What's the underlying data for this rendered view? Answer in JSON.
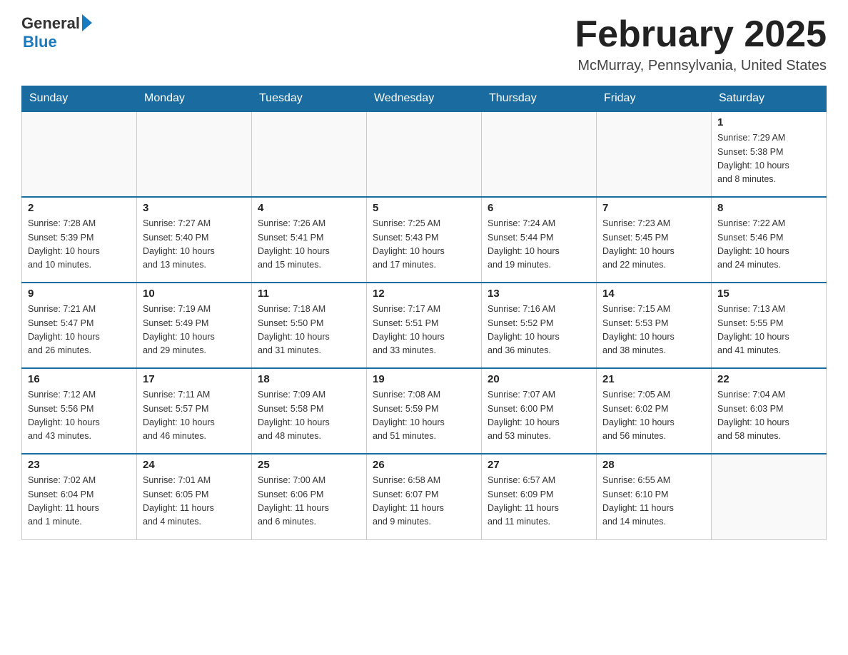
{
  "logo": {
    "general": "General",
    "blue": "Blue"
  },
  "title": "February 2025",
  "location": "McMurray, Pennsylvania, United States",
  "headers": [
    "Sunday",
    "Monday",
    "Tuesday",
    "Wednesday",
    "Thursday",
    "Friday",
    "Saturday"
  ],
  "weeks": [
    [
      {
        "day": "",
        "info": ""
      },
      {
        "day": "",
        "info": ""
      },
      {
        "day": "",
        "info": ""
      },
      {
        "day": "",
        "info": ""
      },
      {
        "day": "",
        "info": ""
      },
      {
        "day": "",
        "info": ""
      },
      {
        "day": "1",
        "info": "Sunrise: 7:29 AM\nSunset: 5:38 PM\nDaylight: 10 hours\nand 8 minutes."
      }
    ],
    [
      {
        "day": "2",
        "info": "Sunrise: 7:28 AM\nSunset: 5:39 PM\nDaylight: 10 hours\nand 10 minutes."
      },
      {
        "day": "3",
        "info": "Sunrise: 7:27 AM\nSunset: 5:40 PM\nDaylight: 10 hours\nand 13 minutes."
      },
      {
        "day": "4",
        "info": "Sunrise: 7:26 AM\nSunset: 5:41 PM\nDaylight: 10 hours\nand 15 minutes."
      },
      {
        "day": "5",
        "info": "Sunrise: 7:25 AM\nSunset: 5:43 PM\nDaylight: 10 hours\nand 17 minutes."
      },
      {
        "day": "6",
        "info": "Sunrise: 7:24 AM\nSunset: 5:44 PM\nDaylight: 10 hours\nand 19 minutes."
      },
      {
        "day": "7",
        "info": "Sunrise: 7:23 AM\nSunset: 5:45 PM\nDaylight: 10 hours\nand 22 minutes."
      },
      {
        "day": "8",
        "info": "Sunrise: 7:22 AM\nSunset: 5:46 PM\nDaylight: 10 hours\nand 24 minutes."
      }
    ],
    [
      {
        "day": "9",
        "info": "Sunrise: 7:21 AM\nSunset: 5:47 PM\nDaylight: 10 hours\nand 26 minutes."
      },
      {
        "day": "10",
        "info": "Sunrise: 7:19 AM\nSunset: 5:49 PM\nDaylight: 10 hours\nand 29 minutes."
      },
      {
        "day": "11",
        "info": "Sunrise: 7:18 AM\nSunset: 5:50 PM\nDaylight: 10 hours\nand 31 minutes."
      },
      {
        "day": "12",
        "info": "Sunrise: 7:17 AM\nSunset: 5:51 PM\nDaylight: 10 hours\nand 33 minutes."
      },
      {
        "day": "13",
        "info": "Sunrise: 7:16 AM\nSunset: 5:52 PM\nDaylight: 10 hours\nand 36 minutes."
      },
      {
        "day": "14",
        "info": "Sunrise: 7:15 AM\nSunset: 5:53 PM\nDaylight: 10 hours\nand 38 minutes."
      },
      {
        "day": "15",
        "info": "Sunrise: 7:13 AM\nSunset: 5:55 PM\nDaylight: 10 hours\nand 41 minutes."
      }
    ],
    [
      {
        "day": "16",
        "info": "Sunrise: 7:12 AM\nSunset: 5:56 PM\nDaylight: 10 hours\nand 43 minutes."
      },
      {
        "day": "17",
        "info": "Sunrise: 7:11 AM\nSunset: 5:57 PM\nDaylight: 10 hours\nand 46 minutes."
      },
      {
        "day": "18",
        "info": "Sunrise: 7:09 AM\nSunset: 5:58 PM\nDaylight: 10 hours\nand 48 minutes."
      },
      {
        "day": "19",
        "info": "Sunrise: 7:08 AM\nSunset: 5:59 PM\nDaylight: 10 hours\nand 51 minutes."
      },
      {
        "day": "20",
        "info": "Sunrise: 7:07 AM\nSunset: 6:00 PM\nDaylight: 10 hours\nand 53 minutes."
      },
      {
        "day": "21",
        "info": "Sunrise: 7:05 AM\nSunset: 6:02 PM\nDaylight: 10 hours\nand 56 minutes."
      },
      {
        "day": "22",
        "info": "Sunrise: 7:04 AM\nSunset: 6:03 PM\nDaylight: 10 hours\nand 58 minutes."
      }
    ],
    [
      {
        "day": "23",
        "info": "Sunrise: 7:02 AM\nSunset: 6:04 PM\nDaylight: 11 hours\nand 1 minute."
      },
      {
        "day": "24",
        "info": "Sunrise: 7:01 AM\nSunset: 6:05 PM\nDaylight: 11 hours\nand 4 minutes."
      },
      {
        "day": "25",
        "info": "Sunrise: 7:00 AM\nSunset: 6:06 PM\nDaylight: 11 hours\nand 6 minutes."
      },
      {
        "day": "26",
        "info": "Sunrise: 6:58 AM\nSunset: 6:07 PM\nDaylight: 11 hours\nand 9 minutes."
      },
      {
        "day": "27",
        "info": "Sunrise: 6:57 AM\nSunset: 6:09 PM\nDaylight: 11 hours\nand 11 minutes."
      },
      {
        "day": "28",
        "info": "Sunrise: 6:55 AM\nSunset: 6:10 PM\nDaylight: 11 hours\nand 14 minutes."
      },
      {
        "day": "",
        "info": ""
      }
    ]
  ]
}
